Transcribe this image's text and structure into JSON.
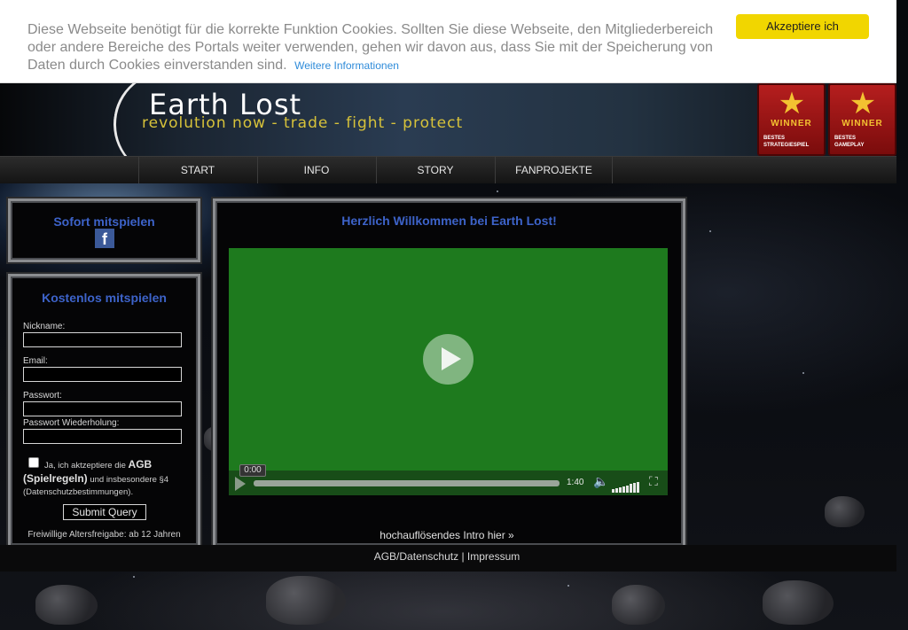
{
  "cookie": {
    "text": "Diese Webseite benötigt für die korrekte Funktion Cookies. Sollten Sie diese Webseite, den Mitgliederbereich oder andere Bereiche des Portals weiter verwenden, gehen wir davon aus, dass Sie mit der Speicherung von Daten durch Cookies einverstanden sind.",
    "more_link": "Weitere Informationen",
    "accept_label": "Akzeptiere ich",
    "accept_color": "#f1d600"
  },
  "header": {
    "logo_title": "Earth Lost",
    "logo_subtitle": "revolution now - trade - fight - protect",
    "awards": [
      {
        "title": "WINNER",
        "category_line1": "BESTES",
        "category_line2": "STRATEGIESPIEL"
      },
      {
        "title": "WINNER",
        "category_line1": "BESTES",
        "category_line2": "GAMEPLAY"
      }
    ]
  },
  "nav": {
    "items": [
      "START",
      "INFO",
      "STORY",
      "FANPROJEKTE"
    ]
  },
  "sidebar": {
    "play_now": {
      "title": "Sofort mitspielen",
      "icon": "facebook-icon"
    },
    "register": {
      "title": "Kostenlos mitspielen",
      "nickname_label": "Nickname:",
      "email_label": "Email:",
      "password_label": "Passwort:",
      "password_repeat_label": "Passwort Wiederholung:",
      "terms_prefix": "Ja, ich aktzeptiere die ",
      "terms_bold": "AGB (Spielregeln)",
      "terms_suffix": " und insbesondere §4 (Datenschutzbestimmungen).",
      "submit_label": "Submit Query",
      "age_rating": "Freiwillige Altersfreigabe: ab 12 Jahren"
    }
  },
  "main": {
    "welcome_title": "Herzlich Willkommen bei Earth Lost!",
    "video": {
      "current_time": "0:00",
      "duration": "1:40",
      "progress": 0
    },
    "intro_link": "hochauflösendes Intro hier »",
    "footer_agb": "AGB/Datenschutz",
    "footer_sep": "|",
    "footer_impressum": "Impressum"
  },
  "colors": {
    "title_blue": "#3d63c9",
    "video_green": "#1e7a1e"
  }
}
